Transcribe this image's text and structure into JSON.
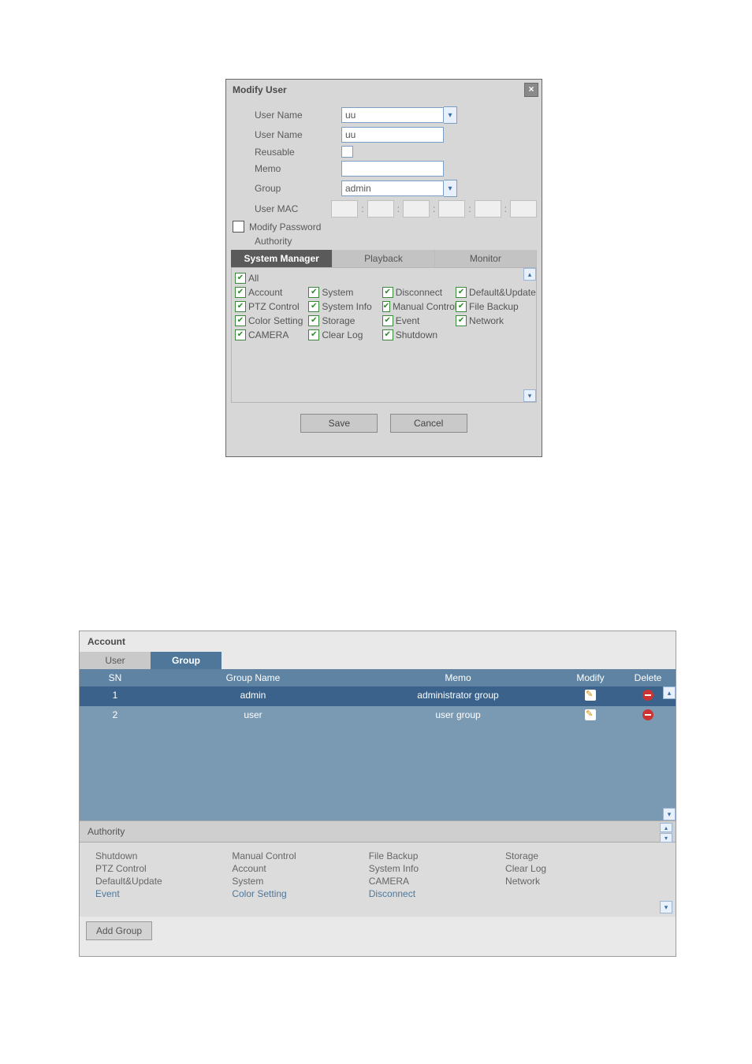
{
  "dialog": {
    "title": "Modify User",
    "labels": {
      "user_name1": "User Name",
      "user_name2": "User Name",
      "reusable": "Reusable",
      "memo": "Memo",
      "group": "Group",
      "user_mac": "User MAC",
      "modify_password": "Modify Password",
      "authority": "Authority"
    },
    "values": {
      "user_name1": "uu",
      "user_name2": "uu",
      "memo": "",
      "group": "admin"
    },
    "mac_sep": ":",
    "tabs": [
      "System Manager",
      "Playback",
      "Monitor"
    ],
    "all_label": "All",
    "columns": [
      [
        "Account",
        "PTZ Control",
        "Color Setting",
        "CAMERA"
      ],
      [
        "System",
        "System Info",
        "Storage",
        "Clear Log"
      ],
      [
        "Disconnect",
        "Manual Control",
        "Event",
        "Shutdown"
      ],
      [
        "Default&Update",
        "File Backup",
        "Network"
      ]
    ],
    "buttons": {
      "save": "Save",
      "cancel": "Cancel"
    }
  },
  "account": {
    "title": "Account",
    "tabs": {
      "user": "User",
      "group": "Group"
    },
    "columns": {
      "sn": "SN",
      "group_name": "Group Name",
      "memo": "Memo",
      "modify": "Modify",
      "delete": "Delete"
    },
    "rows": [
      {
        "sn": "1",
        "name": "admin",
        "memo": "administrator group"
      },
      {
        "sn": "2",
        "name": "user",
        "memo": "user group"
      }
    ],
    "authority_label": "Authority",
    "authority_cols": [
      [
        "Shutdown",
        "PTZ Control",
        "Default&Update",
        "Event"
      ],
      [
        "Manual Control",
        "Account",
        "System",
        "Color Setting"
      ],
      [
        "File Backup",
        "System Info",
        "CAMERA",
        "Disconnect"
      ],
      [
        "Storage",
        "Clear Log",
        "Network"
      ]
    ],
    "add_group": "Add Group"
  }
}
